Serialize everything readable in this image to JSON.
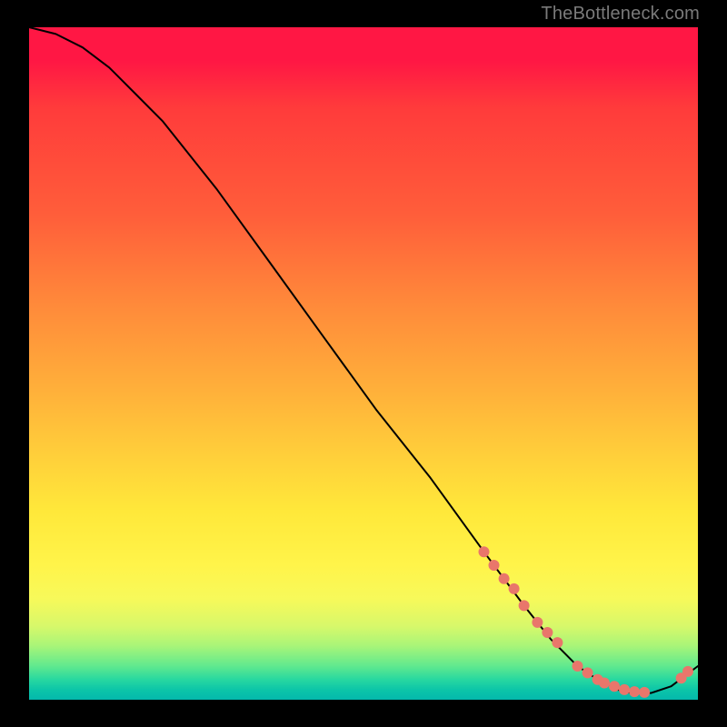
{
  "watermark": "TheBottleneck.com",
  "chart_data": {
    "type": "line",
    "title": "",
    "xlabel": "",
    "ylabel": "",
    "xlim": [
      0,
      100
    ],
    "ylim": [
      0,
      100
    ],
    "grid": false,
    "legend": false,
    "series": [
      {
        "name": "curve",
        "style": "line",
        "color": "#000000",
        "x": [
          0,
          4,
          8,
          12,
          16,
          20,
          28,
          36,
          44,
          52,
          60,
          68,
          74,
          78,
          82,
          85,
          88,
          90,
          93,
          96,
          100
        ],
        "y": [
          100,
          99,
          97,
          94,
          90,
          86,
          76,
          65,
          54,
          43,
          33,
          22,
          14,
          9,
          5,
          3,
          1.5,
          1,
          1,
          2,
          5
        ]
      },
      {
        "name": "highlight-points",
        "style": "scatter",
        "color": "#e9766b",
        "x": [
          68,
          69.5,
          71,
          72.5,
          74,
          76,
          77.5,
          79,
          82,
          83.5,
          85,
          86,
          87.5,
          89,
          90.5,
          92,
          97.5,
          98.5
        ],
        "y": [
          22,
          20,
          18,
          16.5,
          14,
          11.5,
          10,
          8.5,
          5,
          4,
          3,
          2.5,
          2,
          1.5,
          1.2,
          1.1,
          3.2,
          4.2
        ]
      }
    ]
  }
}
